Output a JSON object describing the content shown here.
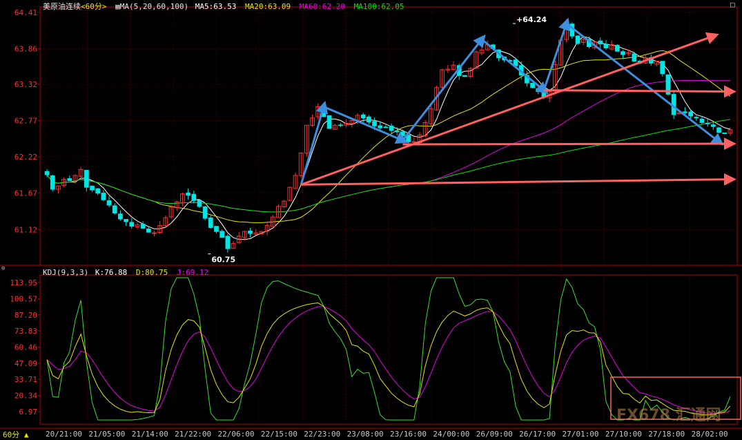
{
  "colors": {
    "axis": "#b40000",
    "grid": "#4a0000",
    "text": "#c8c8c8",
    "up": "#ff3030",
    "down": "#00e5e5",
    "ma5": "#ffffff",
    "ma20": "#e6e600",
    "ma60": "#e600e6",
    "ma100": "#00e600",
    "k": "#ffffff",
    "d": "#e6e600",
    "j": "#e600e6",
    "trend_up": "#3d8fe0",
    "trend_red": "#ff6060",
    "box": "#ff6060"
  },
  "header": {
    "title": "美原油连续",
    "period": "<60分>",
    "ma_title": "MA(5,20,60,100)",
    "ma5": "MA5:63.53",
    "ma20": "MA20:63.09",
    "ma60": "MA60:62.20",
    "ma100": "MA100:62.05"
  },
  "kdj_header": {
    "title": "KDJ(9,3,3)",
    "k": "K:76.88",
    "d": "D:80.75",
    "j": "J:69.12"
  },
  "footer": {
    "period_label": "60分"
  },
  "watermark": "FX678 汇通网",
  "chart_data": [
    {
      "type": "candlestick",
      "title": "美原油连续",
      "ylim": [
        60.6,
        64.45
      ],
      "y_ticks": [
        "64.41",
        "63.86",
        "63.32",
        "62.77",
        "62.22",
        "61.67",
        "61.12"
      ],
      "x_ticks": [
        "20/21:00",
        "21/05:00",
        "21/14:00",
        "21/22:00",
        "22/06:00",
        "22/15:00",
        "22/23:00",
        "23/08:00",
        "23/16:00",
        "24/00:00",
        "26/09:00",
        "26/17:00",
        "27/01:00",
        "27/10:00",
        "27/18:00",
        "28/02:00"
      ],
      "annotations": [
        {
          "text": "+64.24",
          "x": 83,
          "y": 64.24
        },
        {
          "text": "60.75",
          "x": 29,
          "y": 60.75
        }
      ],
      "ohlc_close": [
        61.95,
        61.73,
        61.78,
        61.88,
        61.86,
        61.94,
        62.03,
        61.76,
        61.72,
        61.67,
        61.57,
        61.49,
        61.37,
        61.28,
        61.24,
        61.17,
        61.19,
        61.14,
        61.08,
        61.07,
        61.18,
        61.3,
        61.46,
        61.54,
        61.66,
        61.64,
        61.56,
        61.47,
        61.29,
        61.15,
        61.09,
        61.0,
        60.83,
        60.91,
        61.02,
        61.09,
        61.06,
        61.07,
        61.09,
        61.18,
        61.31,
        61.47,
        61.55,
        61.76,
        61.94,
        62.28,
        62.7,
        62.81,
        62.98,
        62.83,
        62.65,
        62.7,
        62.7,
        62.73,
        62.77,
        62.85,
        62.81,
        62.75,
        62.69,
        62.66,
        62.67,
        62.62,
        62.6,
        62.54,
        62.45,
        62.45,
        62.55,
        62.74,
        62.95,
        63.27,
        63.54,
        63.55,
        63.61,
        63.45,
        63.44,
        63.56,
        63.81,
        63.84,
        63.92,
        63.86,
        63.72,
        63.69,
        63.68,
        63.6,
        63.46,
        63.34,
        63.27,
        63.21,
        63.12,
        63.21,
        63.62,
        63.99,
        64.24,
        64.05,
        63.94,
        64.0,
        63.89,
        63.96,
        63.93,
        63.87,
        63.92,
        63.82,
        63.77,
        63.8,
        63.67,
        63.64,
        63.72,
        63.64,
        63.67,
        63.48,
        63.17,
        62.86,
        62.89,
        62.89,
        62.84,
        62.81,
        62.74,
        62.72,
        62.68,
        62.59,
        62.58,
        62.63
      ],
      "series": [
        {
          "name": "MA5",
          "last": 63.53
        },
        {
          "name": "MA20",
          "last": 63.09
        },
        {
          "name": "MA60",
          "last": 62.2
        },
        {
          "name": "MA100",
          "last": 62.05
        }
      ]
    },
    {
      "type": "line",
      "title": "KDJ(9,3,3)",
      "ylim": [
        0,
        118
      ],
      "y_ticks": [
        "113.95",
        "100.57",
        "87.20",
        "73.83",
        "60.46",
        "47.09",
        "33.71",
        "20.34",
        "6.97"
      ],
      "series": [
        {
          "name": "K",
          "last": 76.88
        },
        {
          "name": "D",
          "last": 80.75
        },
        {
          "name": "J",
          "last": 69.12
        }
      ]
    }
  ]
}
